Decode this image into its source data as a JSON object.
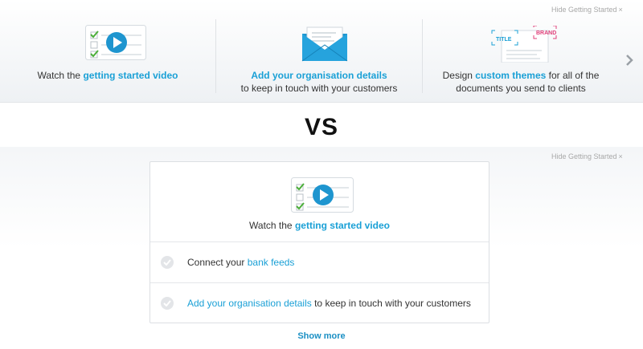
{
  "top": {
    "hide_label": "Hide Getting Started",
    "cards": [
      {
        "pre": "Watch the ",
        "link": "getting started video",
        "post": "",
        "line2": ""
      },
      {
        "pre": "",
        "link": "Add your organisation details",
        "post": "",
        "line2": "to keep in touch with your customers"
      },
      {
        "pre": "Design ",
        "link": "custom themes",
        "post": " for all of the",
        "line2": "documents you send to clients"
      }
    ],
    "theme_tags": [
      "TITLE",
      "BRAND"
    ],
    "next_icon": "chevron-right-icon"
  },
  "vs_label": "VS",
  "bottom": {
    "hide_label": "Hide Getting Started",
    "video": {
      "pre": "Watch the ",
      "link": "getting started video"
    },
    "rows": [
      {
        "pre": "Connect your ",
        "link": "bank feeds",
        "post": ""
      },
      {
        "pre": "",
        "link": "Add your organisation details",
        "post": " to keep in touch with your customers"
      }
    ],
    "show_more": "Show more"
  },
  "colors": {
    "accent": "#1aa0d6",
    "check_green": "#4caf3a",
    "tag_pink": "#e0407a"
  }
}
